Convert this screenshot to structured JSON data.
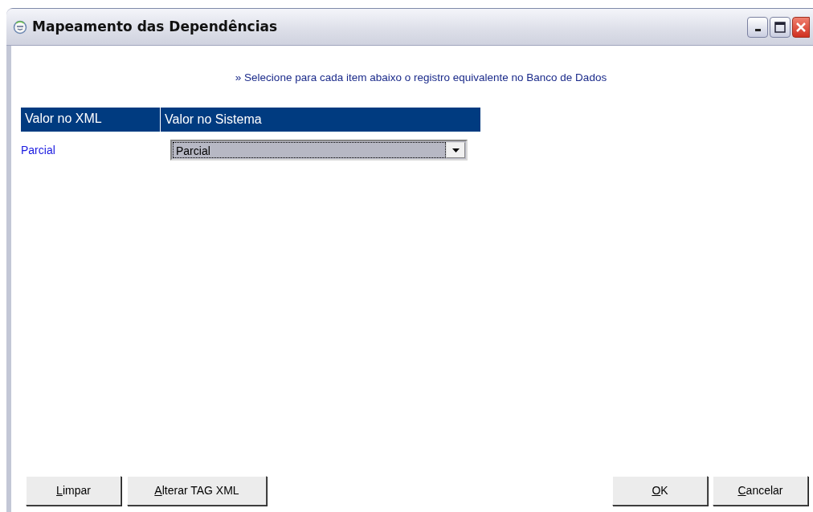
{
  "window": {
    "title": "Mapeamento das Dependências"
  },
  "instruction": "» Selecione para cada item abaixo o registro equivalente no Banco de Dados",
  "table": {
    "columns": [
      "Valor no XML",
      "Valor no Sistema"
    ],
    "rows": [
      {
        "xml_value": "Parcial",
        "system_value": "Parcial"
      }
    ]
  },
  "left_buttons": [
    {
      "label": "Limpar",
      "first_letter_underlined": true
    },
    {
      "label": "Alterar TAG XML",
      "first_letter_underlined": true
    }
  ],
  "right_buttons": [
    {
      "label": "OK",
      "first_letter_underlined": true
    },
    {
      "label": "Cancelar",
      "first_letter_underlined": true
    }
  ]
}
